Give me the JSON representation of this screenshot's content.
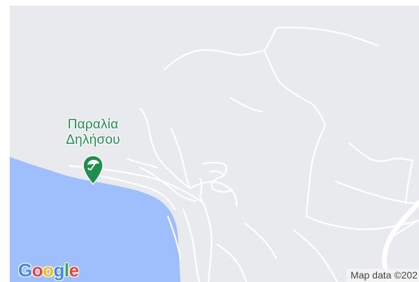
{
  "map": {
    "colors": {
      "land": "#e9eaee",
      "water": "#9ebffb",
      "roads": "#ffffff",
      "poi_green": "#1e8e4d"
    },
    "poi": {
      "label_line1": "Παραλία",
      "label_line2": "Δηλήσου",
      "icon": "beach-umbrella-icon"
    },
    "logo": {
      "letters": [
        "G",
        "o",
        "o",
        "g",
        "l",
        "e"
      ],
      "colors": [
        "#4285f4",
        "#ea4335",
        "#fbbc05",
        "#4285f4",
        "#34a853",
        "#ea4335"
      ]
    },
    "attribution": "Map data ©202"
  }
}
